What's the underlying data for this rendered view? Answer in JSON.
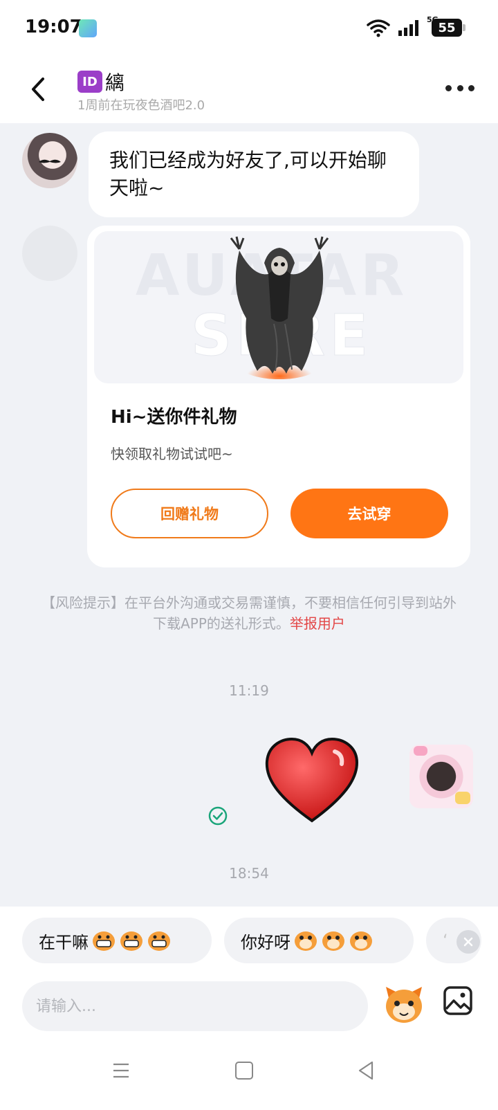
{
  "status_bar": {
    "time": "19:07",
    "network": "5G",
    "battery": "55",
    "icons": [
      "app-notification-icon",
      "wifi-icon",
      "signal-icon",
      "battery-icon"
    ]
  },
  "header": {
    "id_badge": "ID",
    "name": "縭",
    "subtitle": "1周前在玩夜色酒吧2.0",
    "icons": [
      "back-arrow-icon",
      "more-dots-icon"
    ]
  },
  "chat": {
    "friend_message": "我们已经成为好友了,可以开始聊天啦~",
    "gift_card": {
      "image_watermark_line1": "AUATAR",
      "image_watermark_line2": "SPRE",
      "title": "Hi~送你件礼物",
      "description": "快领取礼物试试吧~",
      "return_gift_label": "回赠礼物",
      "try_on_label": "去试穿"
    },
    "risk_notice": "【风险提示】在平台外沟通或交易需谨慎，不要相信任何引导到站外下载APP的送礼形式。",
    "report_link": "举报用户",
    "timestamp_1": "11:19",
    "timestamp_2": "18:54",
    "sent_sticker": "heart-sticker",
    "sent_status": "delivered-check-icon"
  },
  "quick_replies": [
    {
      "label": "在干嘛"
    },
    {
      "label": "你好呀"
    },
    {
      "label": "‘"
    }
  ],
  "input": {
    "placeholder": "请输入..."
  },
  "colors": {
    "accent": "#ff7514",
    "report": "#e34646",
    "chat_bg": "#f0f2f6",
    "id_badge": "#9b3ec8"
  }
}
